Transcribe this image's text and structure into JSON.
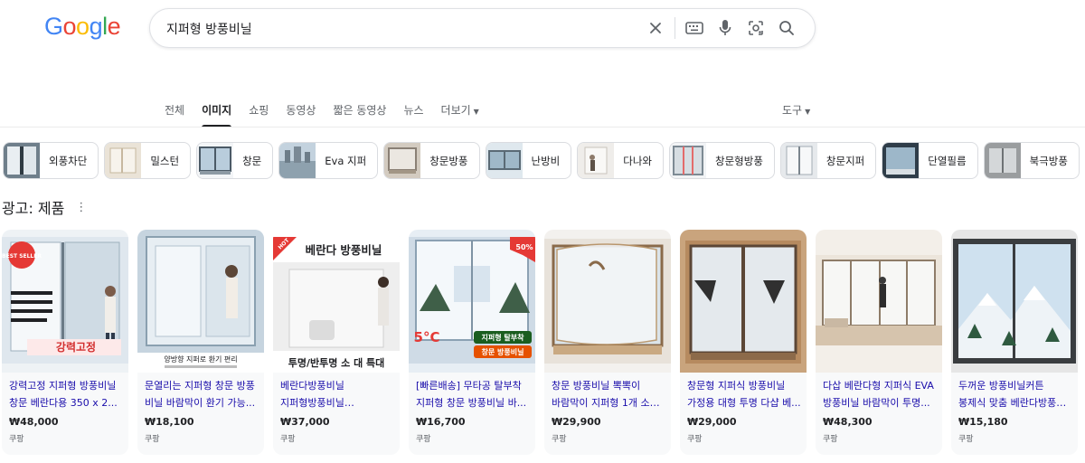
{
  "logo": {
    "letters": [
      "G",
      "o",
      "o",
      "g",
      "l",
      "e"
    ],
    "colors": [
      "#4285F4",
      "#EA4335",
      "#FBBC05",
      "#4285F4",
      "#34A853",
      "#EA4335"
    ]
  },
  "search": {
    "query": "지퍼형 방풍비닐"
  },
  "tabs": [
    {
      "label": "전체",
      "active": false
    },
    {
      "label": "이미지",
      "active": true
    },
    {
      "label": "쇼핑",
      "active": false
    },
    {
      "label": "동영상",
      "active": false
    },
    {
      "label": "짧은 동영상",
      "active": false
    },
    {
      "label": "뉴스",
      "active": false
    },
    {
      "label": "더보기",
      "active": false
    }
  ],
  "tools_label": "도구",
  "chips": [
    {
      "label": "외풍차단",
      "color": "#7a8a96"
    },
    {
      "label": "밀스턴",
      "color": "#d7c7b0"
    },
    {
      "label": "창문",
      "color": "#9fb3c3"
    },
    {
      "label": "Eva 지퍼",
      "color": "#a7b7c5"
    },
    {
      "label": "창문방풍",
      "color": "#c9c0b4"
    },
    {
      "label": "난방비",
      "color": "#b6c7d4"
    },
    {
      "label": "다나와",
      "color": "#e7e4df"
    },
    {
      "label": "창문형방풍",
      "color": "#cfd6db"
    },
    {
      "label": "창문지퍼",
      "color": "#d9dde0"
    },
    {
      "label": "단열필름",
      "color": "#3d4f5f"
    },
    {
      "label": "북극방풍",
      "color": "#a6a9ab"
    }
  ],
  "ads": {
    "title": "광고: 제품",
    "more": "⋮"
  },
  "products": [
    {
      "title": "강력고정 지퍼형 방풍비닐 창문 베란다용 350 x 2...",
      "price": "₩48,000",
      "seller": "쿠팡",
      "img_text": [
        "BEST SELLER",
        "강력고정"
      ]
    },
    {
      "title": "문열리는 지퍼형 창문 방풍 비닐 바람막이 환기 가능...",
      "price": "₩18,100",
      "seller": "쿠팡",
      "img_text": [
        "양방향 지퍼로 환기 편리"
      ]
    },
    {
      "title": "베란다방풍비닐 지퍼형방풍비닐 방풍비닐지퍼 투...",
      "price": "₩37,000",
      "seller": "쿠팡",
      "img_text": [
        "베란다 방풍비닐",
        "투명/반투명 소 대 특대",
        "HOT"
      ]
    },
    {
      "title": "[빠른배송] 무타공 탈부착 지퍼형 창문 방풍비닐 바...",
      "price": "₩16,700",
      "seller": "쿠팡",
      "img_text": [
        "50%",
        "5°C",
        "지퍼형 탈부착",
        "창문 방풍비닐"
      ]
    },
    {
      "title": "창문 방풍비닐 뽁뽁이 바람막이 지퍼형 1개 소(120...",
      "price": "₩29,900",
      "seller": "쿠팡",
      "img_text": []
    },
    {
      "title": "창문형 지퍼식 방풍비닐 가정용 대형 투명 다샵 베...",
      "price": "₩29,000",
      "seller": "쿠팡",
      "img_text": []
    },
    {
      "title": "다삽 베란다형 지퍼식 EVA 방풍비닐 바람막이 투명...",
      "price": "₩48,300",
      "seller": "쿠팡",
      "img_text": []
    },
    {
      "title": "두꺼운 방풍비닐커튼 봉제식 맞춤 베란다방풍막 창...",
      "price": "₩15,180",
      "seller": "쿠팡",
      "img_text": []
    }
  ]
}
